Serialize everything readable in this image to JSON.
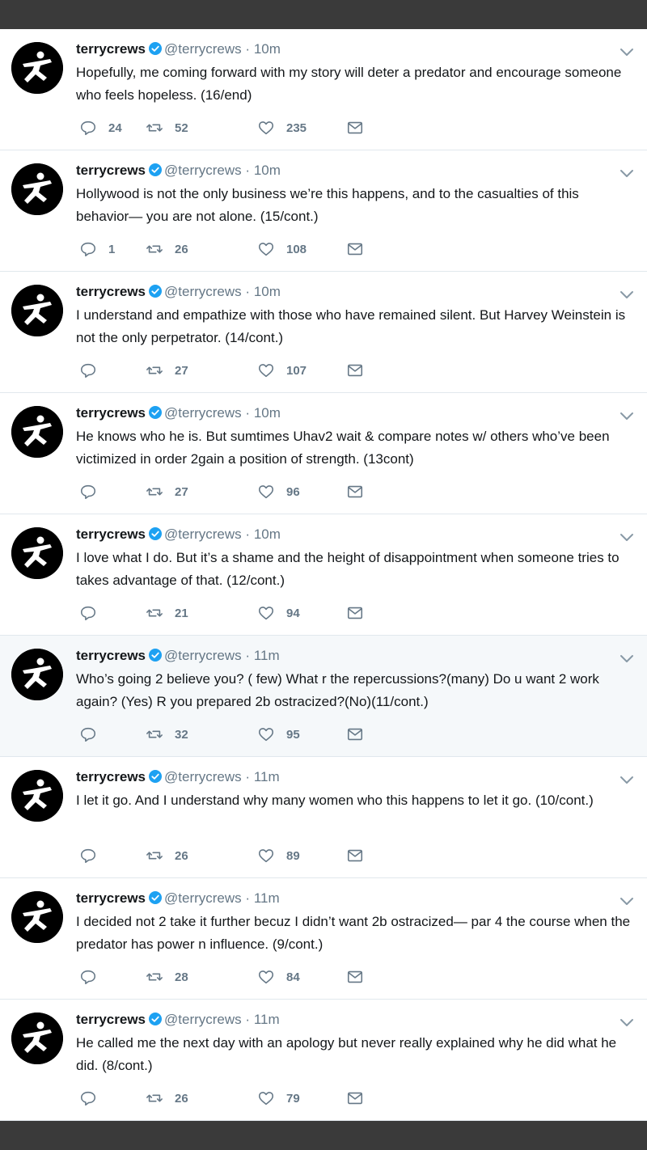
{
  "colors": {
    "text": "#14171a",
    "muted": "#657786",
    "verified": "#1da1f2",
    "highlight_bg": "#f5f8fa",
    "bar": "#3a3a3a"
  },
  "icons": [
    "avatar-silhouette",
    "verified-badge-icon",
    "chevron-down-icon",
    "reply-icon",
    "retweet-icon",
    "heart-icon",
    "envelope-icon"
  ],
  "tweets": [
    {
      "name": "terrycrews",
      "handle": "@terrycrews",
      "separator": "·",
      "time": "10m",
      "text": "Hopefully, me coming forward with my story will deter a predator and encourage someone who feels hopeless. (16/end)",
      "replies": "24",
      "retweets": "52",
      "likes": "235",
      "highlighted": false
    },
    {
      "name": "terrycrews",
      "handle": "@terrycrews",
      "separator": "·",
      "time": "10m",
      "text": "Hollywood is not the only business we’re this happens, and to the casualties of this behavior— you are not alone. (15/cont.)",
      "replies": "1",
      "retweets": "26",
      "likes": "108",
      "highlighted": false
    },
    {
      "name": "terrycrews",
      "handle": "@terrycrews",
      "separator": "·",
      "time": "10m",
      "text": "I understand and empathize with those who have remained silent. But Harvey Weinstein is not the only perpetrator. (14/cont.)",
      "replies": "",
      "retweets": "27",
      "likes": "107",
      "highlighted": false
    },
    {
      "name": "terrycrews",
      "handle": "@terrycrews",
      "separator": "·",
      "time": "10m",
      "text": "He knows who he is. But sumtimes Uhav2 wait & compare notes w/ others who’ve been victimized in order 2gain a position of strength. (13cont)",
      "replies": "",
      "retweets": "27",
      "likes": "96",
      "highlighted": false
    },
    {
      "name": "terrycrews",
      "handle": "@terrycrews",
      "separator": "·",
      "time": "10m",
      "text": "I love what I do. But it’s a shame and the height of disappointment when someone tries to takes advantage of that. (12/cont.)",
      "replies": "",
      "retweets": "21",
      "likes": "94",
      "highlighted": false
    },
    {
      "name": "terrycrews",
      "handle": "@terrycrews",
      "separator": "·",
      "time": "11m",
      "text": "Who’s going 2 believe you? ( few) What r the repercussions?(many) Do u want 2 work again? (Yes) R you prepared 2b ostracized?(No)(11/cont.)",
      "replies": "",
      "retweets": "32",
      "likes": "95",
      "highlighted": true
    },
    {
      "name": "terrycrews",
      "handle": "@terrycrews",
      "separator": "·",
      "time": "11m",
      "text": "I let it go. And I understand why many women who this happens to let it go. (10/cont.)",
      "replies": "",
      "retweets": "26",
      "likes": "89",
      "highlighted": false
    },
    {
      "name": "terrycrews",
      "handle": "@terrycrews",
      "separator": "·",
      "time": "11m",
      "text": "I decided not 2 take it further becuz I didn’t want 2b ostracized— par 4 the course when the predator has power n influence. (9/cont.)",
      "replies": "",
      "retweets": "28",
      "likes": "84",
      "highlighted": false
    },
    {
      "name": "terrycrews",
      "handle": "@terrycrews",
      "separator": "·",
      "time": "11m",
      "text": "He called me the next day with an apology but never really explained why he did what he did. (8/cont.)",
      "replies": "",
      "retweets": "26",
      "likes": "79",
      "highlighted": false
    }
  ]
}
